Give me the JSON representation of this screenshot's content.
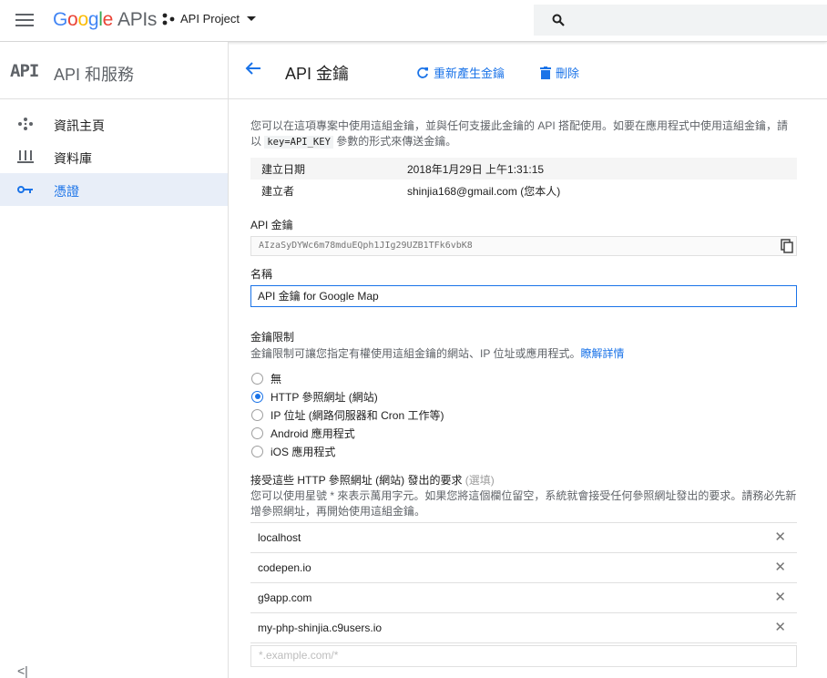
{
  "topbar": {
    "logo_google": "Google",
    "logo_apis": "APIs",
    "project_name": "API Project"
  },
  "sidebar": {
    "badge": "API",
    "title": "API 和服務",
    "items": [
      {
        "label": "資訊主頁",
        "icon": "dashboard-icon"
      },
      {
        "label": "資料庫",
        "icon": "library-icon"
      },
      {
        "label": "憑證",
        "icon": "key-icon",
        "active": true
      }
    ],
    "collapse_glyph": "<|"
  },
  "header": {
    "title": "API 金鑰",
    "regenerate_label": "重新產生金鑰",
    "delete_label": "刪除"
  },
  "content": {
    "description_part1": "您可以在這項專案中使用這組金鑰，並與任何支援此金鑰的 API 搭配使用。如要在應用程式中使用這組金鑰，請以",
    "description_code": "key=API_KEY",
    "description_part2": "參數的形式來傳送金鑰。",
    "meta": [
      {
        "key": "建立日期",
        "value": "2018年1月29日 上午1:31:15"
      },
      {
        "key": "建立者",
        "value": "shinjia168@gmail.com (您本人)"
      }
    ],
    "api_key_label": "API 金鑰",
    "api_key_value": "AIzaSyDYWc6m78mduEQph1JIg29UZB1TFk6vbK8",
    "name_label": "名稱",
    "name_value": "API 金鑰 for Google Map",
    "restriction_title": "金鑰限制",
    "restriction_desc": "金鑰限制可讓您指定有權使用這組金鑰的網站、IP 位址或應用程式。",
    "learn_more": "瞭解詳情",
    "restrictions": [
      {
        "label": "無",
        "selected": false
      },
      {
        "label": "HTTP 參照網址 (網站)",
        "selected": true
      },
      {
        "label": "IP 位址 (網路伺服器和 Cron 工作等)",
        "selected": false
      },
      {
        "label": "Android 應用程式",
        "selected": false
      },
      {
        "label": "iOS 應用程式",
        "selected": false
      }
    ],
    "referrer_title": "接受這些 HTTP 參照網址 (網站) 發出的要求",
    "referrer_optional": "(選填)",
    "referrer_desc": "您可以使用星號 * 來表示萬用字元。如果您將這個欄位留空，系統就會接受任何參照網址發出的要求。請務必先新增參照網址，再開始使用這組金鑰。",
    "referrers": [
      "localhost",
      "codepen.io",
      "g9app.com",
      "my-php-shinjia.c9users.io"
    ],
    "new_referrer_placeholder": "*.example.com/*"
  },
  "colors": {
    "accent": "#1a73e8",
    "active_bg": "#e8eef8"
  }
}
